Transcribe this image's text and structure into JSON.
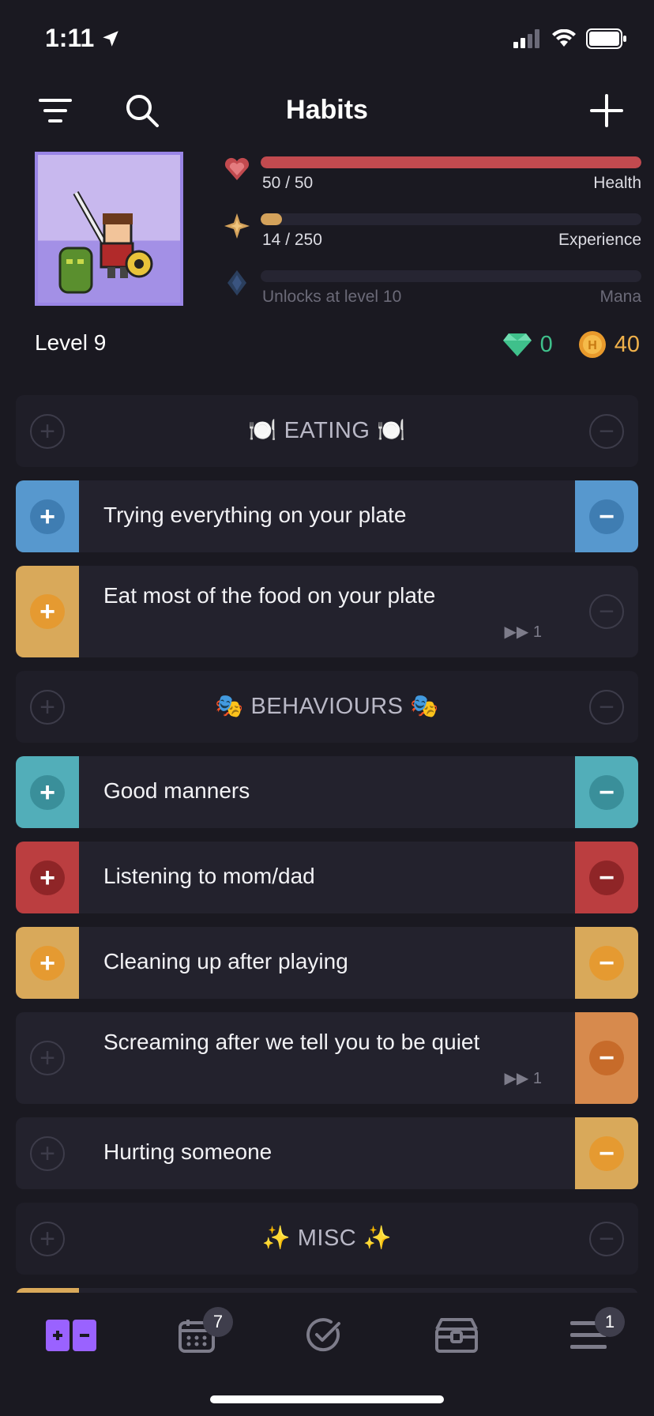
{
  "status": {
    "time": "1:11"
  },
  "header": {
    "title": "Habits"
  },
  "stats": {
    "health": {
      "value": "50 / 50",
      "label": "Health",
      "fill": 1.0,
      "color": "#c24a4f"
    },
    "experience": {
      "value": "14 / 250",
      "label": "Experience",
      "fill": 0.056,
      "color": "#d4a25b"
    },
    "mana": {
      "value": "Unlocks at level 10",
      "label": "Mana"
    }
  },
  "level": "Level 9",
  "currency": {
    "gems": "0",
    "gold": "40"
  },
  "list": {
    "eating": {
      "title": "🍽️ EATING 🍽️"
    },
    "habit1": {
      "text": "Trying everything on your plate",
      "color": "#5798ce"
    },
    "habit2": {
      "text": "Eat most of the food on your plate",
      "streak": "1",
      "color": "#d9a95a"
    },
    "behaviours": {
      "title": "🎭 BEHAVIOURS 🎭"
    },
    "habit3": {
      "text": "Good manners",
      "color": "#52aeb9"
    },
    "habit4": {
      "text": "Listening to mom/dad",
      "color": "#bb3e40"
    },
    "habit5": {
      "text": "Cleaning up after playing",
      "color": "#d9a95a"
    },
    "habit6": {
      "text": "Screaming after we tell you to be quiet",
      "streak": "1",
      "color": "#d78a4d"
    },
    "habit7": {
      "text": "Hurting someone",
      "color": "#d9a95a"
    },
    "misc": {
      "title": "✨ MISC ✨"
    }
  },
  "tabbar": {
    "dailies_badge": "7",
    "menu_badge": "1"
  }
}
